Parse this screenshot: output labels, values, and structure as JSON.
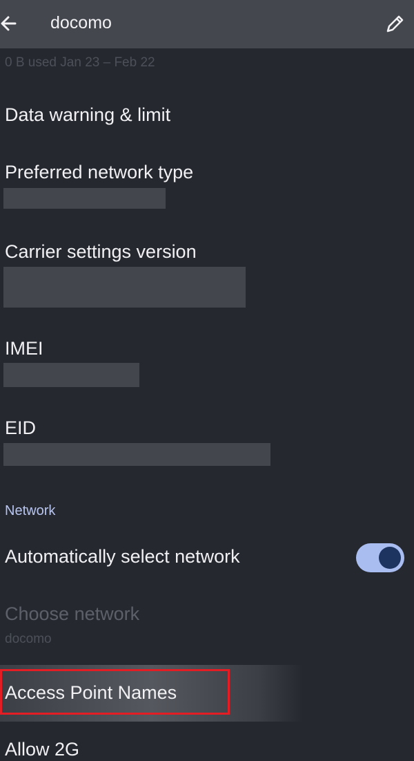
{
  "header": {
    "title": "docomo",
    "back_icon": "arrow-left-icon",
    "edit_icon": "pencil-icon"
  },
  "usage": "0 B used Jan 23 – Feb 22",
  "items": {
    "data_warning": "Data warning & limit",
    "preferred_network": "Preferred network type",
    "carrier_version": "Carrier settings version",
    "imei": "IMEI",
    "eid": "EID"
  },
  "network": {
    "section_label": "Network",
    "auto_select": "Automatically select network",
    "auto_select_on": true,
    "choose_network": "Choose network",
    "choose_network_value": "docomo",
    "apn": "Access Point Names",
    "allow_2g": "Allow 2G"
  },
  "colors": {
    "accent": "#a9bdf1",
    "toggle_knob": "#1d3461",
    "highlight_border": "#e41c24"
  }
}
